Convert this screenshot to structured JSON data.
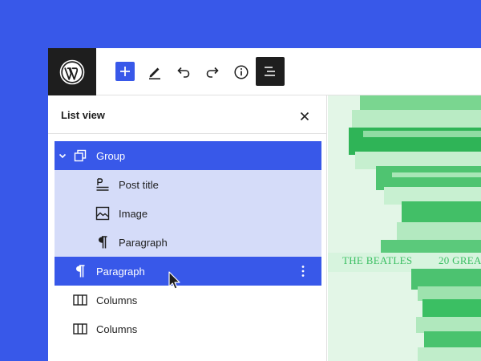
{
  "toolbar": {
    "wp_logo": "wordpress-logo",
    "add_block": "plus-icon",
    "tools": "pencil-icon",
    "undo": "undo-icon",
    "redo": "redo-icon",
    "details": "info-icon",
    "list_view": "list-view-icon"
  },
  "list_view": {
    "title": "List view",
    "items": [
      {
        "label": "Group",
        "icon": "group-icon",
        "state": "selected",
        "expanded": true
      },
      {
        "label": "Post title",
        "icon": "post-title-icon",
        "state": "child-highlight"
      },
      {
        "label": "Image",
        "icon": "image-icon",
        "state": "child-highlight"
      },
      {
        "label": "Paragraph",
        "icon": "paragraph-icon",
        "state": "child-highlight"
      },
      {
        "label": "Paragraph",
        "icon": "paragraph-icon",
        "state": "selected"
      },
      {
        "label": "Columns",
        "icon": "columns-icon",
        "state": "normal"
      },
      {
        "label": "Columns",
        "icon": "columns-icon",
        "state": "normal"
      }
    ]
  },
  "canvas": {
    "book_text_left": "THE BEATLES",
    "book_text_right": "20 GREA"
  },
  "colors": {
    "accent": "#3858e9",
    "dark": "#1e1e1e",
    "child_highlight": "#d5dcf9",
    "image_green": "#3bbf63"
  }
}
